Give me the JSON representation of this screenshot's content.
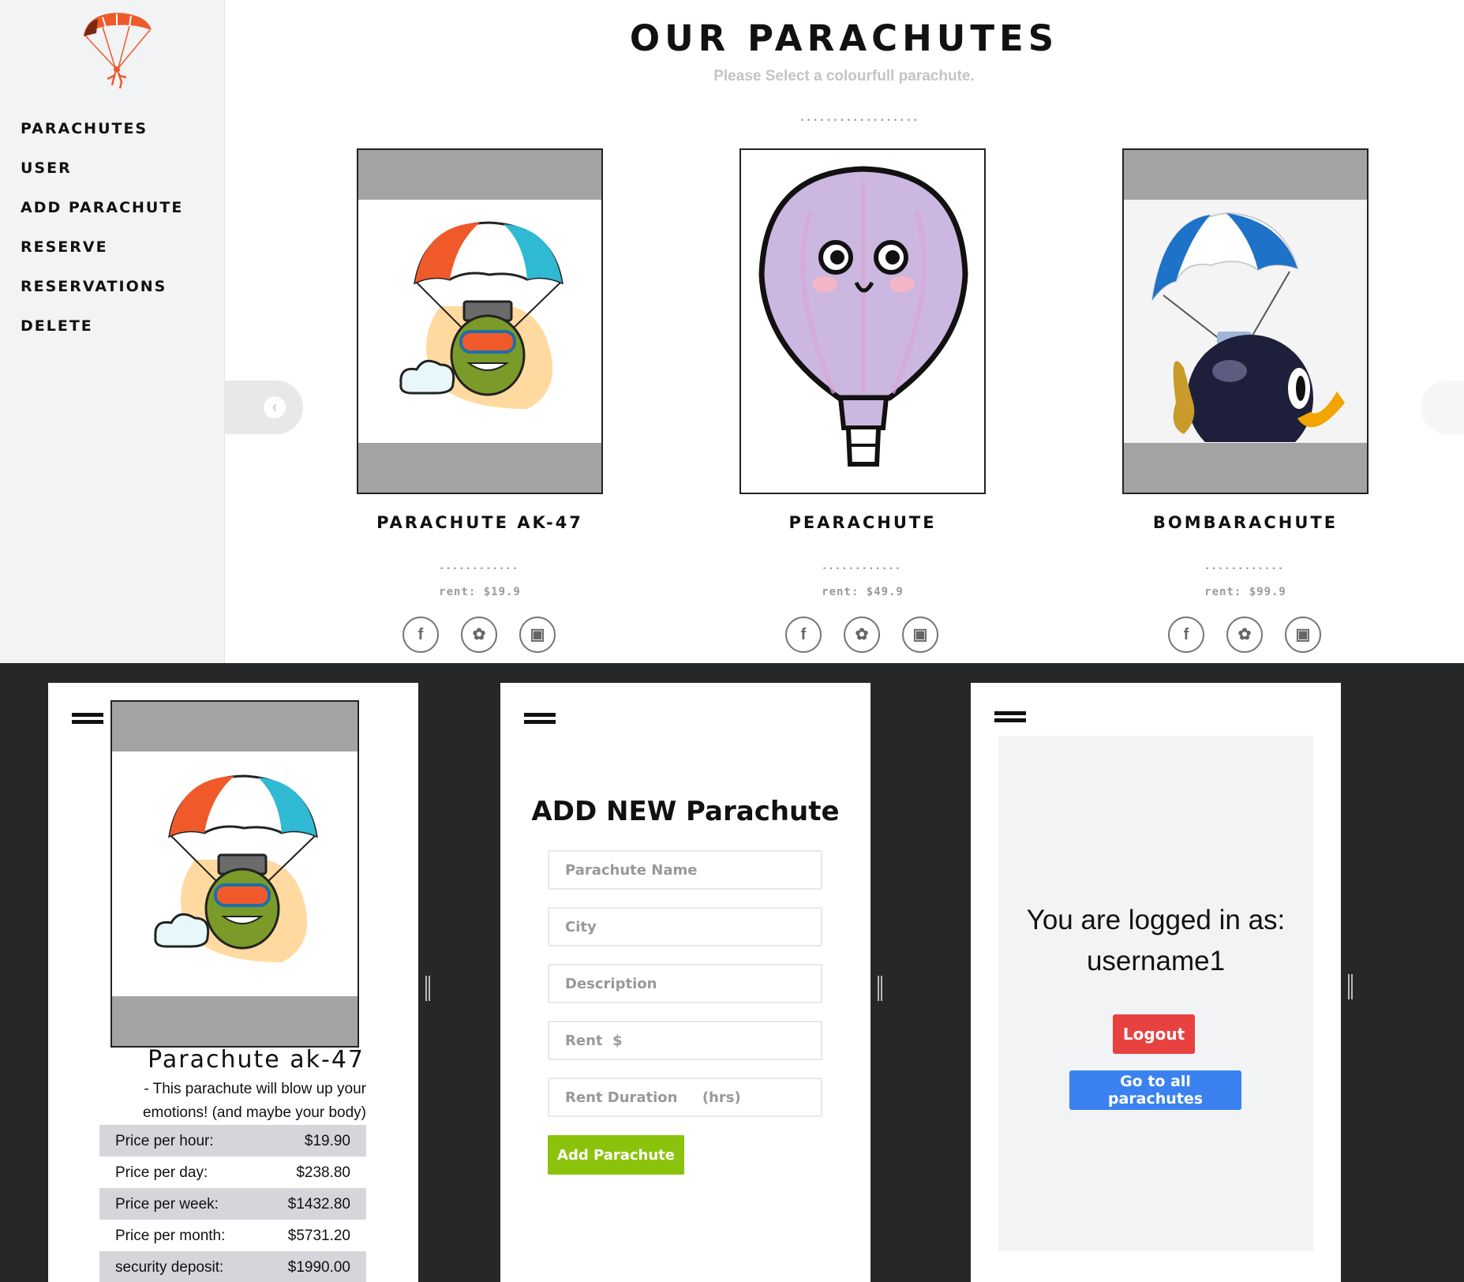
{
  "colors": {
    "sidebar_bg": "#f2f3f5",
    "accent_logo": "#ef5a2a",
    "card_band": "#a3a3a3",
    "add_button": "#8bc30c",
    "logout_button": "#e94040",
    "go_button": "#3b82f0",
    "backdrop": "#262729"
  },
  "sidebar": {
    "logo_icon": "parachute-logo-icon",
    "items": [
      {
        "label": "PARACHUTES"
      },
      {
        "label": "USER"
      },
      {
        "label": "ADD PARACHUTE"
      },
      {
        "label": "RESERVE"
      },
      {
        "label": "RESERVATIONS"
      },
      {
        "label": "DELETE"
      }
    ]
  },
  "main": {
    "title": "OUR PARACHUTES",
    "subtitle": "Please Select a colourfull parachute.",
    "dots": "..................",
    "carousel_prev_icon": "chevron-left-icon",
    "cards": [
      {
        "name": "PARACHUTE AK-47",
        "dots": "............",
        "rent": "rent: $19.9",
        "image": "grenade-parachute-image"
      },
      {
        "name": "PEARACHUTE",
        "dots": "............",
        "rent": "rent: $49.9",
        "image": "hot-air-balloon-image"
      },
      {
        "name": "BOMBARACHUTE",
        "dots": "............",
        "rent": "rent: $99.9",
        "image": "bomb-parachute-image"
      }
    ],
    "social_icons": [
      "facebook-icon",
      "twitter-icon",
      "camera-icon"
    ]
  },
  "detail": {
    "title": "Parachute ak-47",
    "description": "- This parachute will blow up your emotions! (and maybe your body)",
    "prices": [
      {
        "label": "Price per hour:",
        "value": "$19.90"
      },
      {
        "label": "Price per day:",
        "value": "$238.80"
      },
      {
        "label": "Price per week:",
        "value": "$1432.80"
      },
      {
        "label": "Price per month:",
        "value": "$5731.20"
      },
      {
        "label": "security deposit:",
        "value": "$1990.00"
      }
    ]
  },
  "add_form": {
    "title": "ADD NEW Parachute",
    "fields": [
      {
        "placeholder": "Parachute Name"
      },
      {
        "placeholder": "City"
      },
      {
        "placeholder": "Description"
      },
      {
        "placeholder": "Rent  $"
      },
      {
        "placeholder": "Rent Duration     (hrs)"
      }
    ],
    "submit": "Add Parachute"
  },
  "account": {
    "logged_in_as": "You are logged in as:",
    "username": "username1",
    "logout": "Logout",
    "go_all": "Go to all parachutes"
  }
}
